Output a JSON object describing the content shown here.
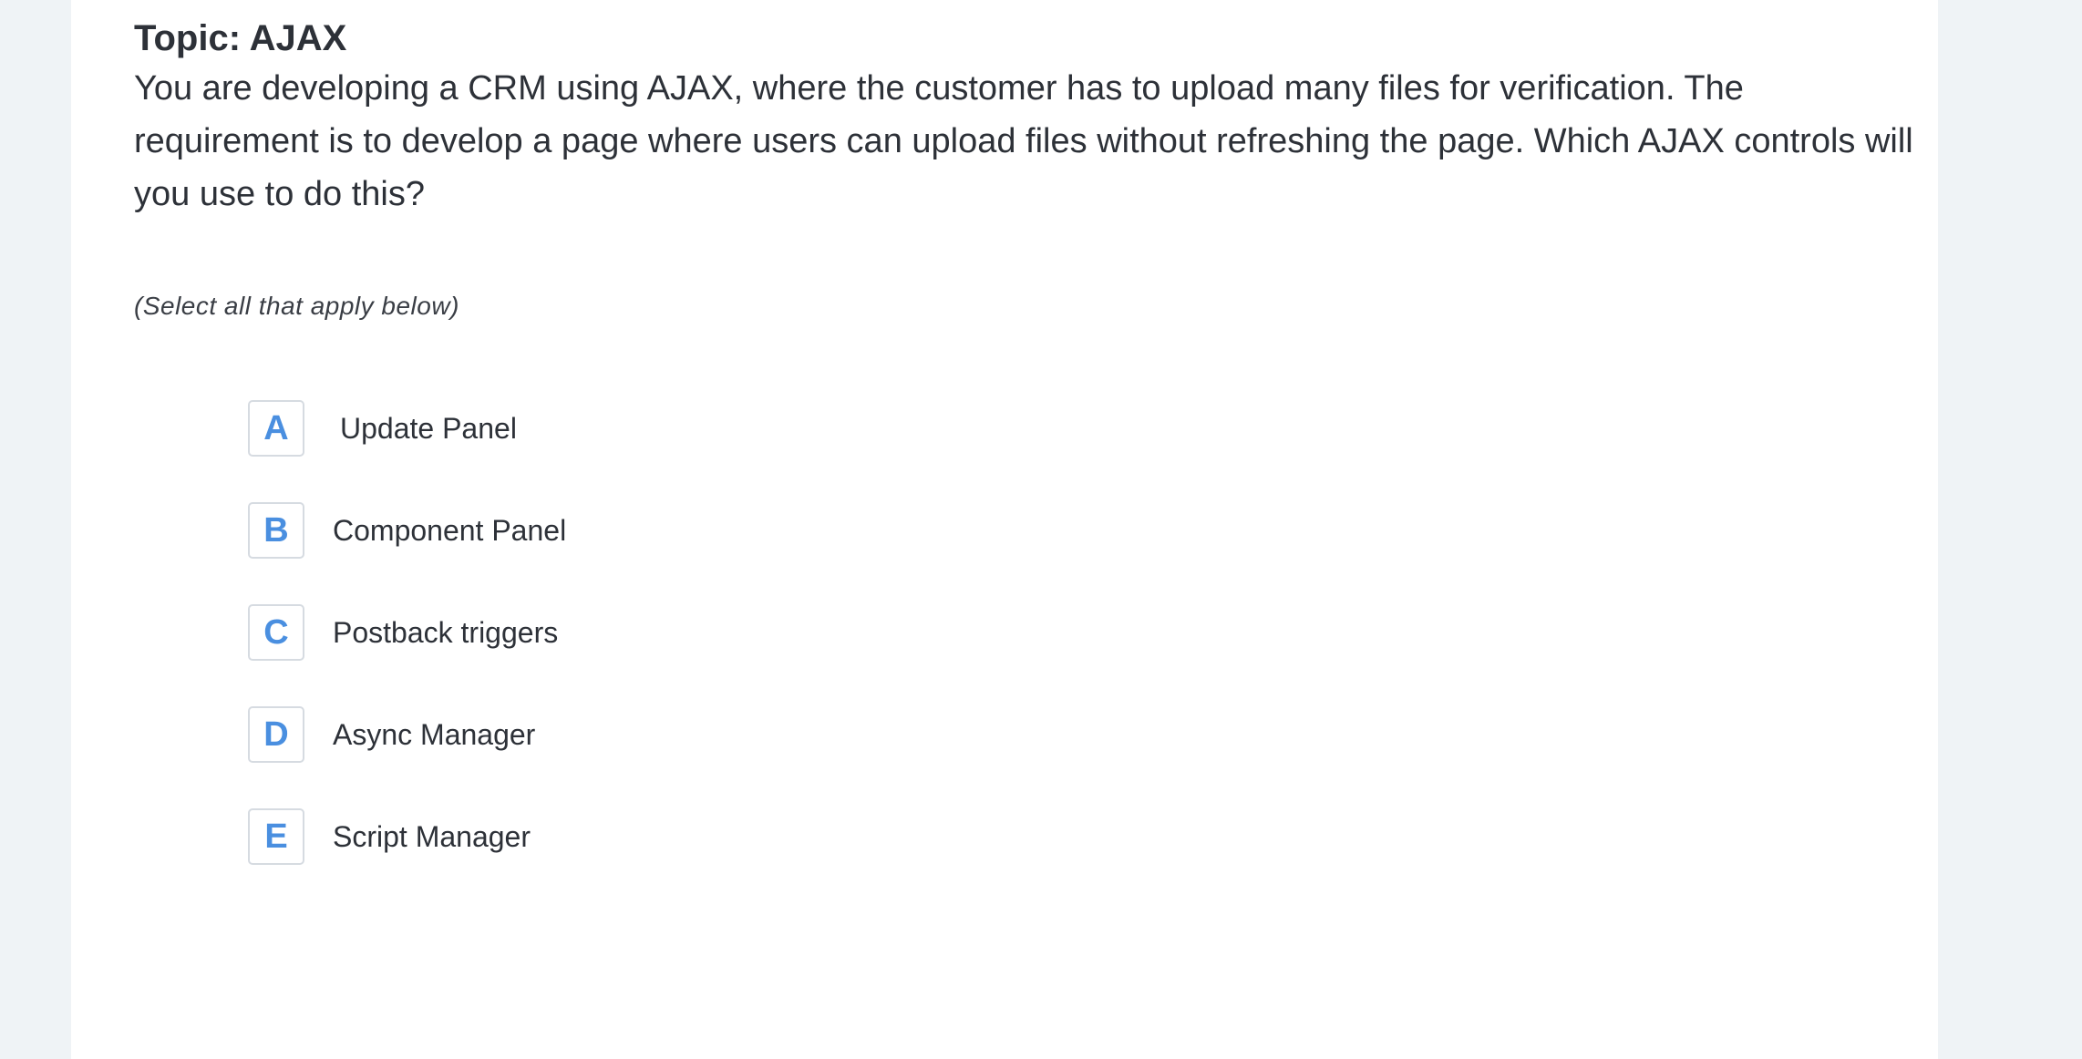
{
  "topic": "Topic: AJAX",
  "question": "You are developing a CRM using AJAX, where the customer has to upload many files for verification. The requirement is to develop a page where users can upload files without refreshing the page. Which AJAX controls will you use to do this?",
  "hint": "(Select all that apply below)",
  "options": [
    {
      "key": "A",
      "label": "Update Panel"
    },
    {
      "key": "B",
      "label": "Component Panel"
    },
    {
      "key": "C",
      "label": "Postback triggers"
    },
    {
      "key": "D",
      "label": "Async Manager"
    },
    {
      "key": "E",
      "label": "Script Manager"
    }
  ],
  "colors": {
    "page_background": "#eff3f6",
    "card_background": "#ffffff",
    "text": "#2d3138",
    "option_key": "#4a8fe0",
    "option_border": "#d6dbe1"
  }
}
